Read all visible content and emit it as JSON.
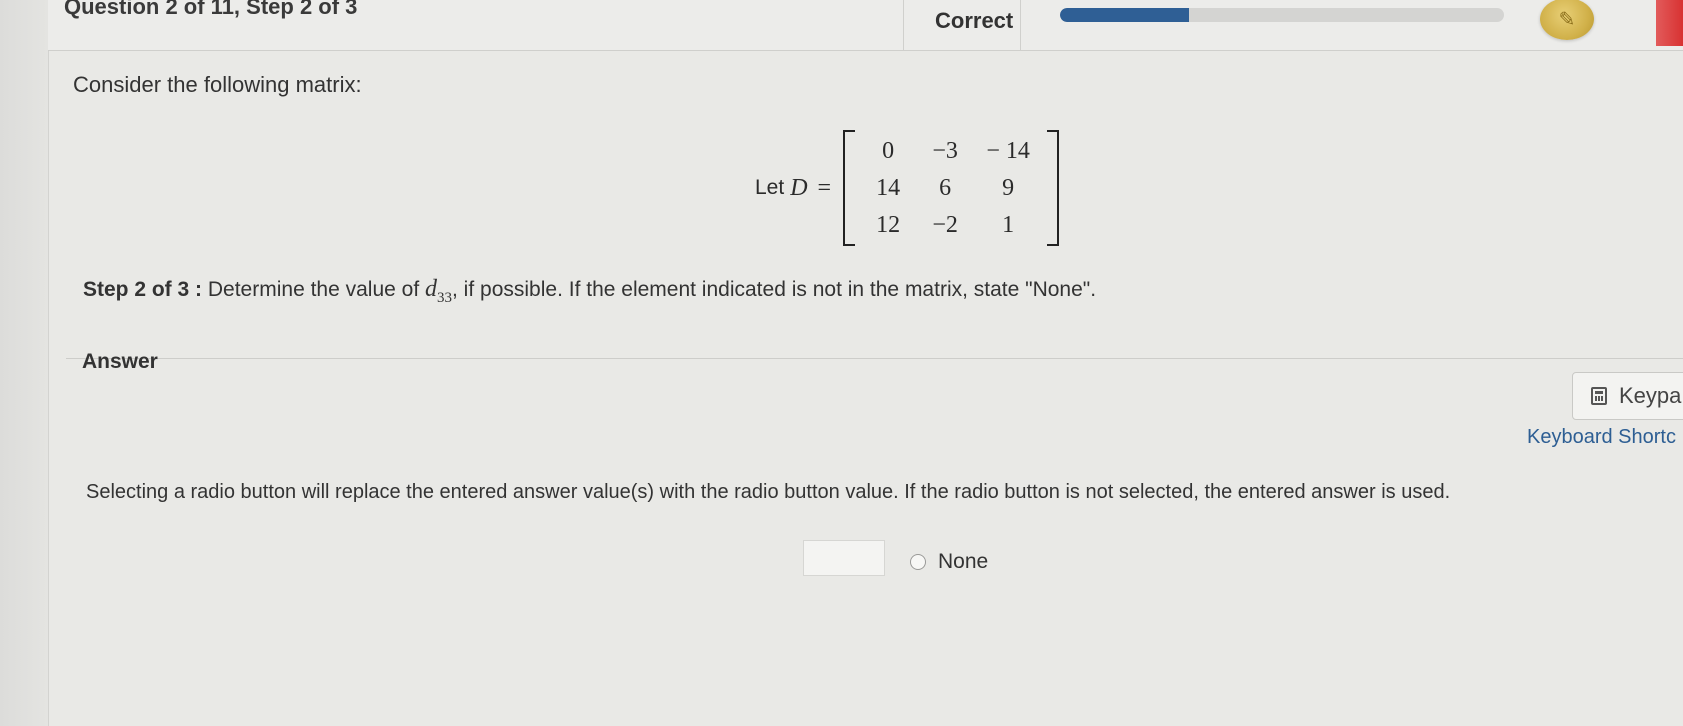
{
  "header": {
    "question_title": "Question 2 of 11, Step 2 of 3",
    "status": "Correct",
    "progress_fraction": 0.29,
    "progress_color": "#2f5f95",
    "badge_icon": "coin-icon"
  },
  "question": {
    "prompt": "Consider the following matrix:",
    "matrix_let": "Let",
    "matrix_var": "D",
    "matrix_eq": "=",
    "matrix": [
      [
        "0",
        "−3",
        "− 14"
      ],
      [
        "14",
        "6",
        "9"
      ],
      [
        "12",
        "−2",
        "1"
      ]
    ],
    "step_label": "Step 2 of 3 :",
    "step_text_before": "Determine the value of",
    "element_var": "d",
    "element_sub": "33",
    "step_text_after": ", if possible. If the element indicated is not in the matrix, state \"None\"."
  },
  "answer": {
    "label": "Answer",
    "keypad_label": "Keypa",
    "keyboard_shortcuts_label": "Keyboard Shortc",
    "instruction": "Selecting a radio button will replace the entered answer value(s) with the radio button value. If the radio button is not selected, the entered answer is used.",
    "input_value": "",
    "radio_label": "None",
    "radio_selected": false
  }
}
